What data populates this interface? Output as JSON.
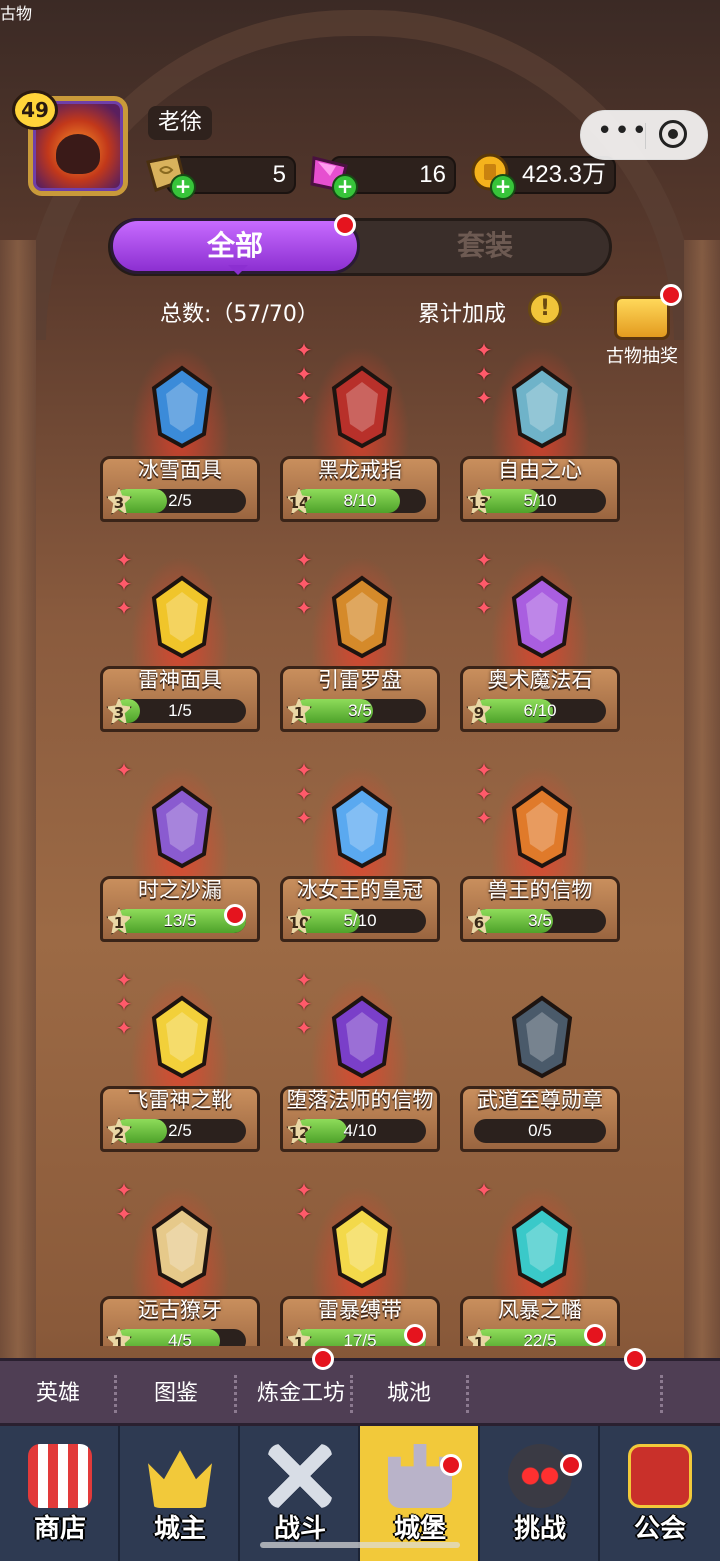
{
  "player": {
    "level": "49",
    "name": "老徐"
  },
  "resources": [
    {
      "name": "stone",
      "value": "5",
      "color": "#d9b25c"
    },
    {
      "name": "gem",
      "value": "16",
      "color": "#e64fd0"
    },
    {
      "name": "gold",
      "value": "423.3万",
      "color": "#f5b21c"
    }
  ],
  "tabs": {
    "all": "全部",
    "set": "套装"
  },
  "summary": {
    "total": "总数:（57/70）",
    "bonus": "累计加成",
    "info": "!"
  },
  "lottery": {
    "label": "古物抽奖"
  },
  "relics": [
    {
      "name": "冰雪面具",
      "progress": "2/5",
      "fraction": 0.4,
      "level": "3",
      "stars": 0,
      "color": "#3b8bd9"
    },
    {
      "name": "黑龙戒指",
      "progress": "8/10",
      "fraction": 0.8,
      "level": "14",
      "stars": 3,
      "color": "#b8302a"
    },
    {
      "name": "自由之心",
      "progress": "5/10",
      "fraction": 0.5,
      "level": "13",
      "stars": 3,
      "color": "#6fb3c9"
    },
    {
      "name": "雷神面具",
      "progress": "1/5",
      "fraction": 0.2,
      "level": "3",
      "stars": 3,
      "color": "#f0c52a"
    },
    {
      "name": "引雷罗盘",
      "progress": "3/5",
      "fraction": 0.6,
      "level": "1",
      "stars": 3,
      "color": "#d58a2a"
    },
    {
      "name": "奥术魔法石",
      "progress": "6/10",
      "fraction": 0.6,
      "level": "9",
      "stars": 3,
      "color": "#a95ee0"
    },
    {
      "name": "时之沙漏",
      "progress": "13/5",
      "fraction": 1.0,
      "level": "1",
      "stars": 1,
      "color": "#8a5bd0"
    },
    {
      "name": "冰女王的皇冠",
      "progress": "5/10",
      "fraction": 0.5,
      "level": "10",
      "stars": 3,
      "color": "#5aa9f0"
    },
    {
      "name": "兽王的信物",
      "progress": "3/5",
      "fraction": 0.6,
      "level": "6",
      "stars": 3,
      "color": "#e07a2a"
    },
    {
      "name": "飞雷神之靴",
      "progress": "2/5",
      "fraction": 0.4,
      "level": "2",
      "stars": 3,
      "color": "#f2d03a"
    },
    {
      "name": "堕落法师的信物",
      "progress": "4/10",
      "fraction": 0.4,
      "level": "12",
      "stars": 3,
      "color": "#7a3fc9"
    },
    {
      "name": "武道至尊勋章",
      "progress": "0/5",
      "fraction": 0.0,
      "level": "",
      "stars": 0,
      "color": "#4a5a6a"
    },
    {
      "name": "远古獠牙",
      "progress": "4/5",
      "fraction": 0.8,
      "level": "1",
      "stars": 2,
      "color": "#e6c98a"
    },
    {
      "name": "雷暴缚带",
      "progress": "17/5",
      "fraction": 1.0,
      "level": "1",
      "stars": 2,
      "color": "#f3d94a"
    },
    {
      "name": "风暴之幡",
      "progress": "22/5",
      "fraction": 1.0,
      "level": "1",
      "stars": 1,
      "color": "#3ac9c9"
    }
  ],
  "subnav": [
    "英雄",
    "图鉴",
    "炼金工坊",
    "城池",
    "古物"
  ],
  "bottomnav": [
    "商店",
    "城主",
    "战斗",
    "城堡",
    "挑战",
    "公会"
  ]
}
